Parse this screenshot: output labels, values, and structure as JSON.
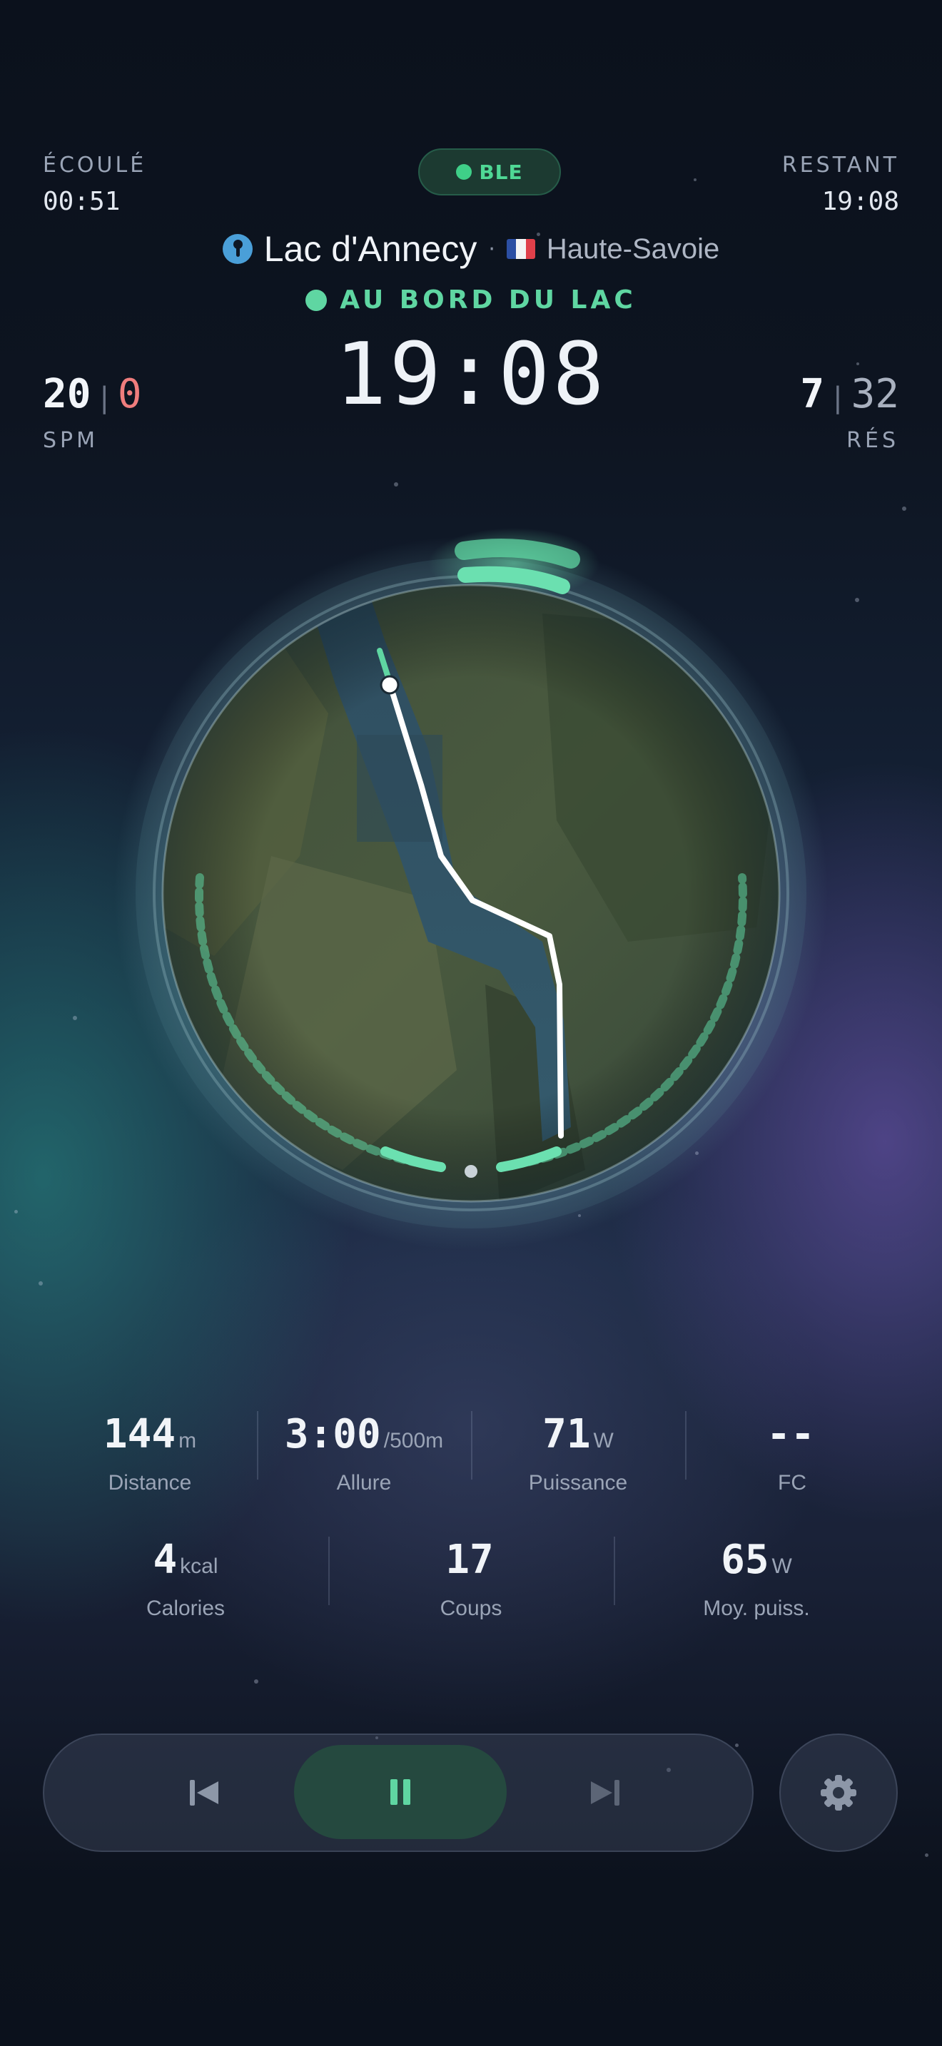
{
  "header": {
    "elapsed_label": "ÉCOULÉ",
    "elapsed_value": "00:51",
    "remaining_label": "RESTANT",
    "remaining_value": "19:08",
    "connection_badge": "BLE"
  },
  "location": {
    "name": "Lac d'Annecy",
    "separator": "·",
    "region": "Haute-Savoie",
    "flag_icon": "flag-france-icon",
    "status": "AU BORD DU LAC"
  },
  "timer": "19:08",
  "left_metric": {
    "primary": "20",
    "divider": "|",
    "secondary": "0",
    "unit": "SPM"
  },
  "right_metric": {
    "primary": "7",
    "divider": "|",
    "secondary": "32",
    "unit": "RÉS"
  },
  "stats_row1": [
    {
      "value": "144",
      "unit": "m",
      "label": "Distance"
    },
    {
      "value": "3:00",
      "unit": "/500m",
      "label": "Allure"
    },
    {
      "value": "71",
      "unit": "W",
      "label": "Puissance"
    },
    {
      "value": "--",
      "unit": "",
      "label": "FC"
    }
  ],
  "stats_row2": [
    {
      "value": "4",
      "unit": "kcal",
      "label": "Calories"
    },
    {
      "value": "17",
      "unit": "",
      "label": "Coups"
    },
    {
      "value": "65",
      "unit": "W",
      "label": "Moy. puiss."
    }
  ],
  "controls": {
    "previous_icon": "skip-previous-icon",
    "pause_icon": "pause-icon",
    "next_icon": "skip-next-icon",
    "settings_icon": "gear-icon"
  },
  "colors": {
    "accent_green": "#5fd6a2",
    "ble_green": "#4fd895",
    "alert_red": "#ef7d7d",
    "route": "#ffffff"
  }
}
